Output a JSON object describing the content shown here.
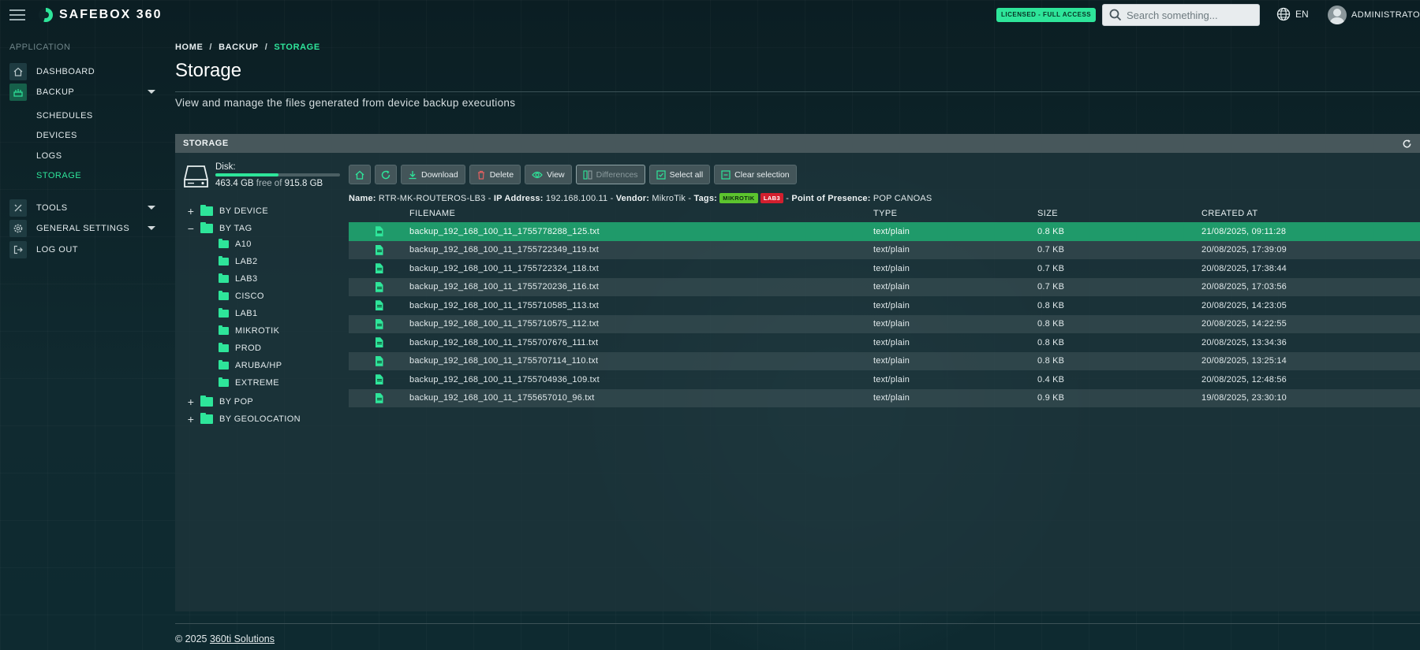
{
  "app": {
    "brand": "SAFEBOX 360",
    "license_badge": "LICENSED - FULL ACCESS"
  },
  "search": {
    "placeholder": "Search something..."
  },
  "lang": {
    "code": "EN"
  },
  "user": {
    "name": "ADMINISTRATOR"
  },
  "sidebar": {
    "section": "APPLICATION",
    "items": [
      {
        "label": "DASHBOARD",
        "icon": "home-icon"
      },
      {
        "label": "BACKUP",
        "icon": "backup-icon"
      },
      {
        "label": "TOOLS",
        "icon": "tools-icon"
      },
      {
        "label": "GENERAL SETTINGS",
        "icon": "gear-icon"
      },
      {
        "label": "LOG OUT",
        "icon": "logout-icon"
      }
    ],
    "backup_sub": [
      "SCHEDULES",
      "DEVICES",
      "LOGS",
      "STORAGE"
    ]
  },
  "breadcrumb": {
    "home": "HOME",
    "backup": "BACKUP",
    "current": "STORAGE"
  },
  "page": {
    "title": "Storage",
    "description": "View and manage the files generated from device backup executions"
  },
  "panel": {
    "title": "STORAGE"
  },
  "disk": {
    "label": "Disk:",
    "used": "463.4 GB",
    "free_of": "free of",
    "total": "915.8 GB",
    "usage_fraction": 0.506
  },
  "tree": {
    "by_device": "BY DEVICE",
    "by_tag": "BY TAG",
    "tags": [
      "A10",
      "LAB2",
      "LAB3",
      "CISCO",
      "LAB1",
      "MIKROTIK",
      "PROD",
      "ARUBA/HP",
      "EXTREME"
    ],
    "by_pop": "BY POP",
    "by_geolocation": "BY GEOLOCATION"
  },
  "toolbar": {
    "download": "Download",
    "delete": "Delete",
    "view": "View",
    "differences": "Differences",
    "select_all": "Select all",
    "clear_selection": "Clear selection"
  },
  "device_info": {
    "name_label": "Name:",
    "name": "RTR-MK-ROUTEROS-LB3",
    "ip_label": "IP Address:",
    "ip": "192.168.100.11",
    "vendor_label": "Vendor:",
    "vendor": "MikroTik",
    "tags_label": "Tags:",
    "tag1": "MIKROTIK",
    "tag2": "LAB3",
    "pop_label": "Point of Presence:",
    "pop": "POP CANOAS"
  },
  "table": {
    "headers": {
      "filename": "FILENAME",
      "type": "TYPE",
      "size": "SIZE",
      "created": "CREATED AT"
    },
    "rows": [
      {
        "filename": "backup_192_168_100_11_1755778288_125.txt",
        "type": "text/plain",
        "size": "0.8 KB",
        "created": "21/08/2025, 09:11:28"
      },
      {
        "filename": "backup_192_168_100_11_1755722349_119.txt",
        "type": "text/plain",
        "size": "0.7 KB",
        "created": "20/08/2025, 17:39:09"
      },
      {
        "filename": "backup_192_168_100_11_1755722324_118.txt",
        "type": "text/plain",
        "size": "0.7 KB",
        "created": "20/08/2025, 17:38:44"
      },
      {
        "filename": "backup_192_168_100_11_1755720236_116.txt",
        "type": "text/plain",
        "size": "0.7 KB",
        "created": "20/08/2025, 17:03:56"
      },
      {
        "filename": "backup_192_168_100_11_1755710585_113.txt",
        "type": "text/plain",
        "size": "0.8 KB",
        "created": "20/08/2025, 14:23:05"
      },
      {
        "filename": "backup_192_168_100_11_1755710575_112.txt",
        "type": "text/plain",
        "size": "0.8 KB",
        "created": "20/08/2025, 14:22:55"
      },
      {
        "filename": "backup_192_168_100_11_1755707676_111.txt",
        "type": "text/plain",
        "size": "0.8 KB",
        "created": "20/08/2025, 13:34:36"
      },
      {
        "filename": "backup_192_168_100_11_1755707114_110.txt",
        "type": "text/plain",
        "size": "0.8 KB",
        "created": "20/08/2025, 13:25:14"
      },
      {
        "filename": "backup_192_168_100_11_1755704936_109.txt",
        "type": "text/plain",
        "size": "0.4 KB",
        "created": "20/08/2025, 12:48:56"
      },
      {
        "filename": "backup_192_168_100_11_1755657010_96.txt",
        "type": "text/plain",
        "size": "0.9 KB",
        "created": "19/08/2025, 23:30:10"
      }
    ]
  },
  "footer": {
    "copyright": "© 2025",
    "link": "360ti Solutions"
  },
  "colors": {
    "accent": "#2ee59a",
    "selected_row": "#1f9a6a",
    "tag_mikrotik": "#5cc42e",
    "tag_lab3": "#d21f2e"
  }
}
